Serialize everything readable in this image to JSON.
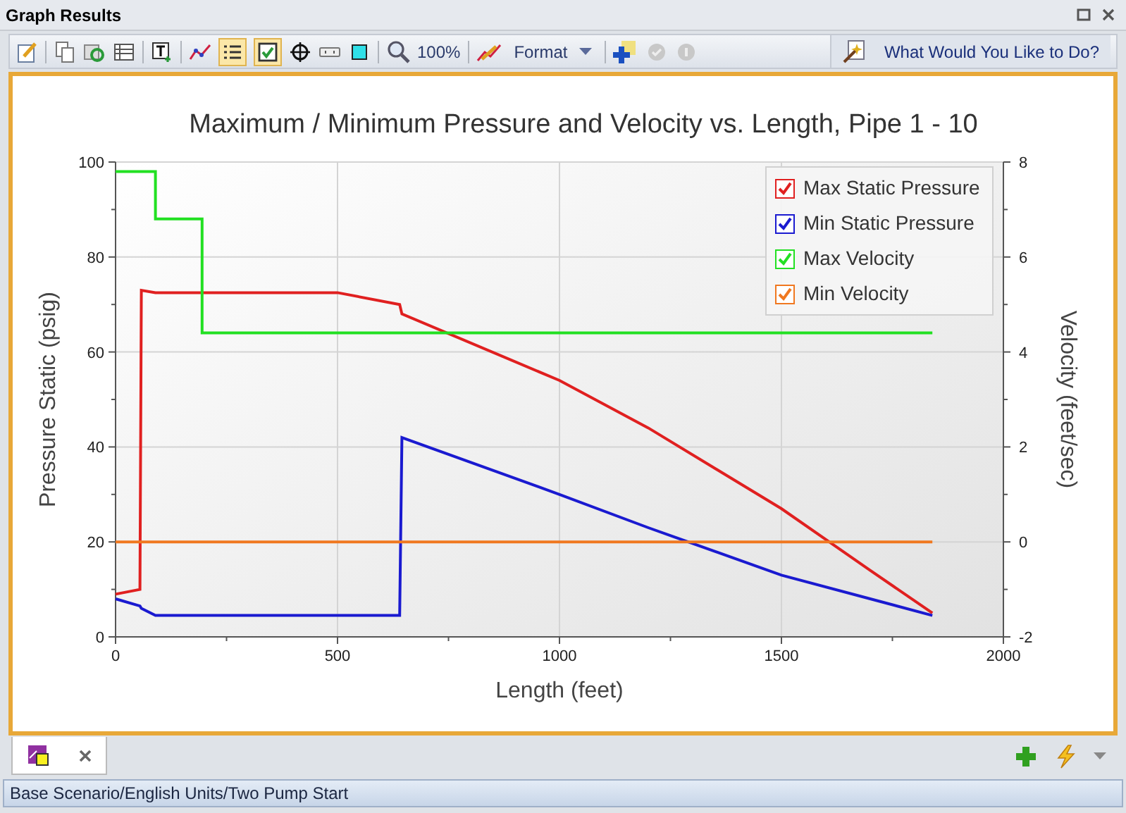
{
  "window": {
    "title": "Graph Results"
  },
  "toolbar": {
    "zoom": "100%",
    "format": "Format",
    "help": "What Would You Like to Do?"
  },
  "chart_data": {
    "type": "line",
    "title": "Maximum / Minimum Pressure and Velocity vs. Length, Pipe 1 - 10",
    "xlabel": "Length (feet)",
    "ylabel": "Pressure Static (psig)",
    "y2label": "Velocity (feet/sec)",
    "x": [
      0,
      55,
      58,
      90,
      90,
      195,
      195,
      500,
      640,
      645,
      1000,
      1200,
      1500,
      1700,
      1840
    ],
    "series": [
      {
        "name": "Max Static Pressure",
        "color": "#e02020",
        "values": [
          9,
          10,
          73,
          72.5,
          72.5,
          72.5,
          72.5,
          72.5,
          70,
          68,
          54,
          44,
          27,
          14,
          5
        ]
      },
      {
        "name": "Min Static Pressure",
        "color": "#1a1ad0",
        "values": [
          8,
          6.5,
          6,
          4.5,
          4.5,
          4.5,
          4.5,
          4.5,
          4.5,
          42,
          30,
          23,
          13,
          8,
          4.5
        ]
      },
      {
        "name": "Max Velocity",
        "color": "#22e022",
        "axis": "y2",
        "values": [
          7.8,
          7.8,
          7.8,
          7.8,
          6.8,
          6.8,
          4.4,
          4.4,
          4.4,
          4.4,
          4.4,
          4.4,
          4.4,
          4.4,
          4.4
        ]
      },
      {
        "name": "Min Velocity",
        "color": "#f07820",
        "axis": "y2",
        "values": [
          0,
          0,
          0,
          0,
          0,
          0,
          0,
          0,
          0,
          0,
          0,
          0,
          0,
          0,
          0
        ]
      }
    ],
    "xlim": [
      0,
      2000
    ],
    "ylim": [
      0,
      100
    ],
    "y2lim": [
      -2,
      8
    ],
    "xticks": [
      0,
      500,
      1000,
      1500,
      2000
    ],
    "yticks": [
      0,
      20,
      40,
      60,
      80,
      100
    ],
    "y2ticks": [
      -2,
      0,
      2,
      4,
      6,
      8
    ],
    "grid": true,
    "legend": "upper right"
  },
  "legend_checkboxes": [
    {
      "checked": true
    },
    {
      "checked": true
    },
    {
      "checked": true
    },
    {
      "checked": true
    }
  ],
  "status_bar": "Base Scenario/English Units/Two Pump Start"
}
